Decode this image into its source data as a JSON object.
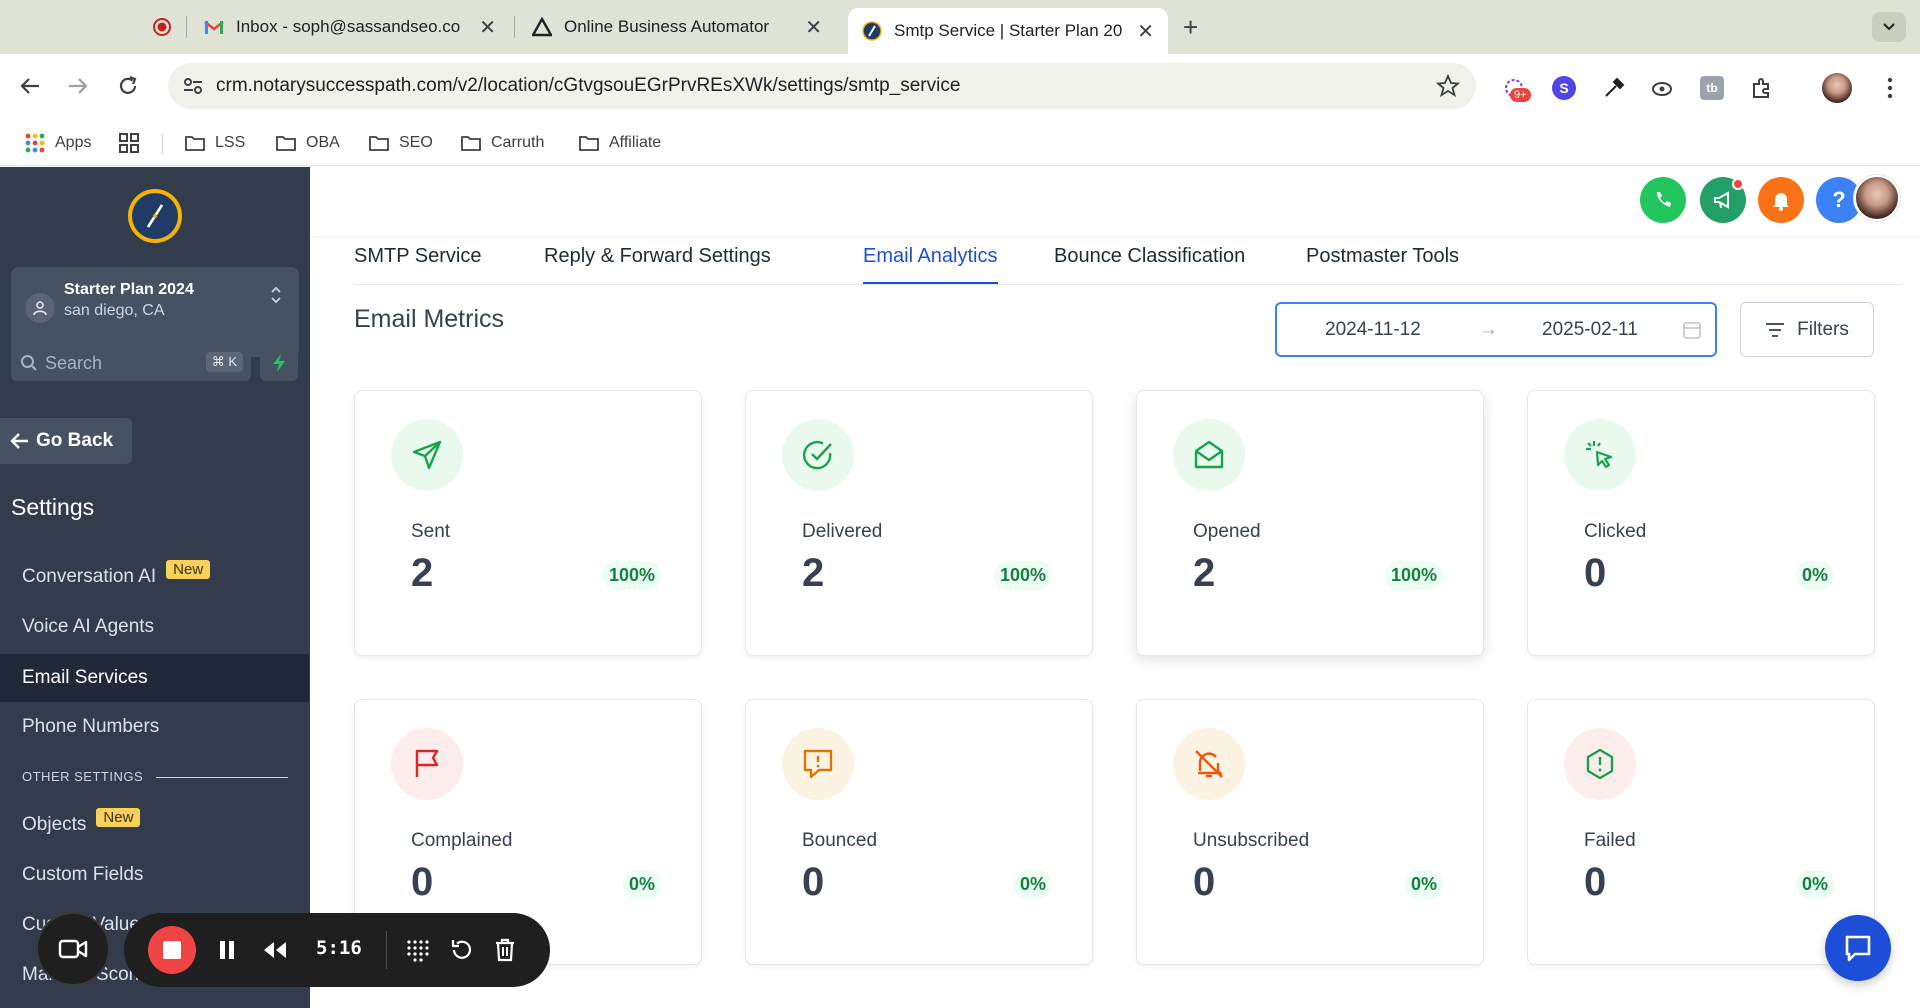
{
  "browser": {
    "tabs": [
      {
        "title": "",
        "icon": "record-icon"
      },
      {
        "title": "Inbox - soph@sassandseo.co",
        "icon": "gmail-icon"
      },
      {
        "title": "Online Business Automator",
        "icon": "triangle-logo-icon"
      },
      {
        "title": "Smtp Service | Starter Plan 20",
        "icon": "compass-logo-icon"
      }
    ],
    "url": "crm.notarysuccesspath.com/v2/location/cGtvgsouEGrPrvREsXWk/settings/smtp_service",
    "ext_badge": "9+",
    "ext_s_label": "S",
    "bookmarks": [
      {
        "label": "Apps"
      },
      {
        "label": "LSS"
      },
      {
        "label": "OBA"
      },
      {
        "label": "SEO"
      },
      {
        "label": "Carruth"
      },
      {
        "label": "Affiliate"
      }
    ]
  },
  "sidebar": {
    "location_name": "Starter Plan 2024",
    "location_sub": "san diego, CA",
    "search_placeholder": "Search",
    "search_shortcut": "⌘ K",
    "go_back": "Go Back",
    "settings_title": "Settings",
    "items": [
      {
        "label": "Conversation AI",
        "badge": "New"
      },
      {
        "label": "Voice AI Agents"
      },
      {
        "label": "Email Services"
      },
      {
        "label": "Phone Numbers"
      }
    ],
    "other_label": "OTHER SETTINGS",
    "other_items": [
      {
        "label": "Objects",
        "badge": "New"
      },
      {
        "label": "Custom Fields"
      },
      {
        "label": "Custom Values"
      },
      {
        "label": "Manage Scoring"
      }
    ]
  },
  "subtabs": [
    "SMTP Service",
    "Reply & Forward Settings",
    "Email Analytics",
    "Bounce Classification",
    "Postmaster Tools"
  ],
  "active_subtab": "Email Analytics",
  "metrics": {
    "title": "Email Metrics",
    "date_from": "2024-11-12",
    "date_arrow": "→",
    "date_to": "2025-02-11",
    "filters_label": "Filters",
    "cards": [
      {
        "label": "Sent",
        "value": "2",
        "pct": "100%",
        "icon": "paper-plane-icon",
        "color": "#16a34a",
        "bg": "#e9f9ee"
      },
      {
        "label": "Delivered",
        "value": "2",
        "pct": "100%",
        "icon": "check-circle-icon",
        "color": "#16a34a",
        "bg": "#e9f9ee"
      },
      {
        "label": "Opened",
        "value": "2",
        "pct": "100%",
        "icon": "open-envelope-icon",
        "color": "#16a34a",
        "bg": "#e9f9ee"
      },
      {
        "label": "Clicked",
        "value": "0",
        "pct": "0%",
        "icon": "cursor-click-icon",
        "color": "#16a34a",
        "bg": "#e9f9ee"
      },
      {
        "label": "Complained",
        "value": "0",
        "pct": "0%",
        "icon": "flag-icon",
        "color": "#dc2626",
        "bg": "#fdecec"
      },
      {
        "label": "Bounced",
        "value": "0",
        "pct": "0%",
        "icon": "alert-message-icon",
        "color": "#d97706",
        "bg": "#fdf3e2"
      },
      {
        "label": "Unsubscribed",
        "value": "0",
        "pct": "0%",
        "icon": "bell-off-icon",
        "color": "#ea580c",
        "bg": "#fdf3e2"
      },
      {
        "label": "Failed",
        "value": "0",
        "pct": "0%",
        "icon": "alert-hexagon-icon",
        "color": "#16a34a",
        "bg": "#fdecec"
      }
    ]
  },
  "recorder": {
    "time": "5:16"
  },
  "colors": {
    "accent": "#1d4ed8",
    "sidebar_bg": "#323c4d",
    "success": "#15803d"
  }
}
